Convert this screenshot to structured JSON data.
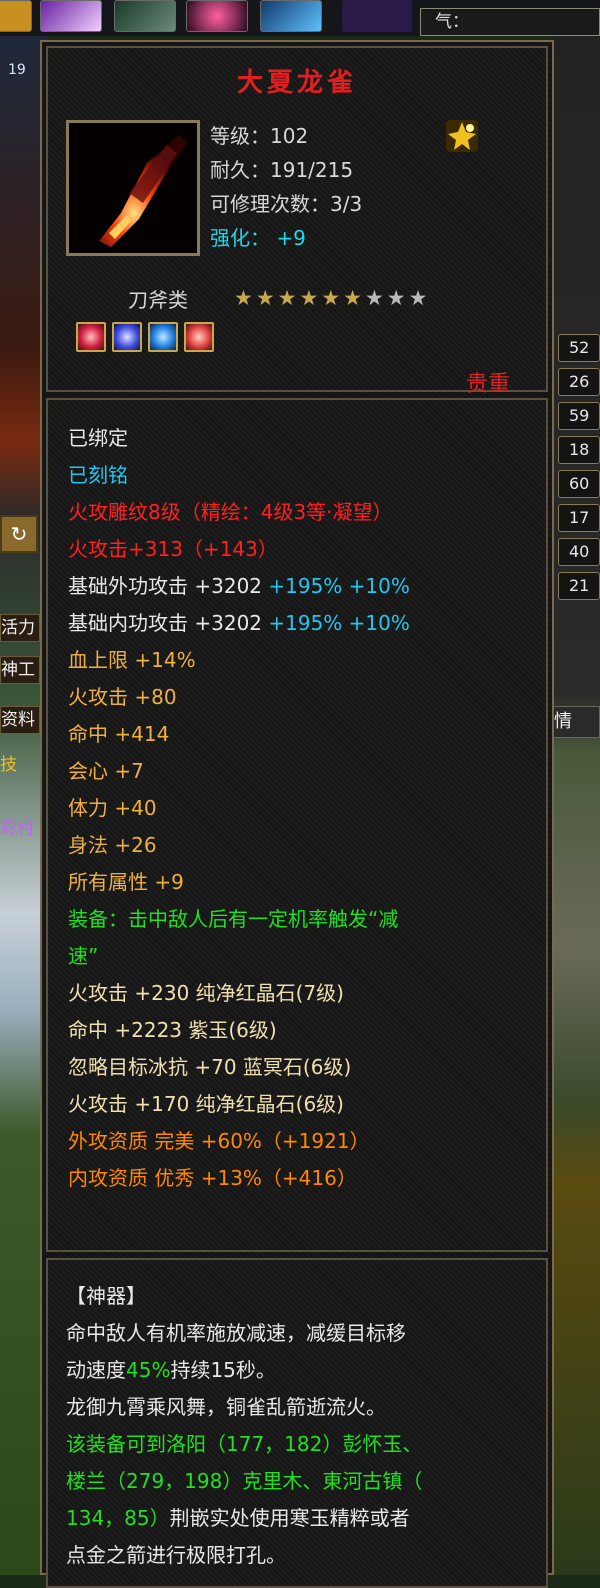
{
  "top": {
    "qi_label": "气：",
    "left_level": "19",
    "side_numbers": [
      "52",
      "26",
      "59",
      "18",
      "60",
      "17",
      "40",
      "21"
    ],
    "left_labels": [
      "活力",
      "神工",
      "资料",
      "技",
      "彩村"
    ],
    "right_label": "情"
  },
  "item": {
    "name": "大夏龙雀",
    "level_label": "等级：102",
    "durability_label": "耐久：191/215",
    "repair_label": "可修理次数：3/3",
    "enhance_label": "强化：",
    "enhance_value": "+9",
    "category": "刀斧类",
    "stars_filled": 6,
    "stars_total": 9,
    "rarity": "贵重",
    "gems": [
      "red-gem",
      "blue-gem",
      "blue-gem",
      "red-gem"
    ]
  },
  "attrs": {
    "bound": "已绑定",
    "engraved": "已刻铭",
    "carving": "火攻雕纹8级（精绘：4级3等·凝望）",
    "fire_attack_main": "火攻击+313（+143）",
    "base_outer_label": "基础外功攻击 +3202",
    "base_outer_pct": "+195% +10%",
    "base_inner_label": "基础内功攻击 +3202",
    "base_inner_pct": "+195% +10%",
    "hp_max": "血上限 +14%",
    "fire_attack": "火攻击 +80",
    "hit": "命中 +414",
    "crit": "会心 +7",
    "stamina": "体力 +40",
    "agility": "身法 +26",
    "all_attr": "所有属性 +9",
    "equip_effect_1": "装备：击中敌人后有一定机率触发“减",
    "equip_effect_2": "速”",
    "gem_1": "火攻击 +230 纯净红晶石(7级)",
    "gem_2": "命中 +2223 紫玉(6级)",
    "gem_3": "忽略目标冰抗 +70 蓝冥石(6级)",
    "gem_4": "火攻击 +170 纯净红晶石(6级)",
    "quality_outer": "外攻资质  完美 +60%（+1921）",
    "quality_inner": "内攻资质  优秀 +13%（+416）"
  },
  "artifact": {
    "header": "【神器】",
    "effect_1": "命中敌人有机率施放减速，减缓目标移",
    "effect_2a": "动速度",
    "effect_2b": "45%",
    "effect_2c": "持续15秒。",
    "poem": "龙御九霄乘风舞，铜雀乱箭逝流火。",
    "loc_1": "该装备可到洛阳（177，182）彭怀玉、",
    "loc_2": "楼兰（279，198）克里木、東河古镇（",
    "loc_3a": "134，85）",
    "loc_3b": "荆嵌实处使用寒玉精粹或者",
    "loc_4": "点金之箭进行极限打孔。"
  }
}
